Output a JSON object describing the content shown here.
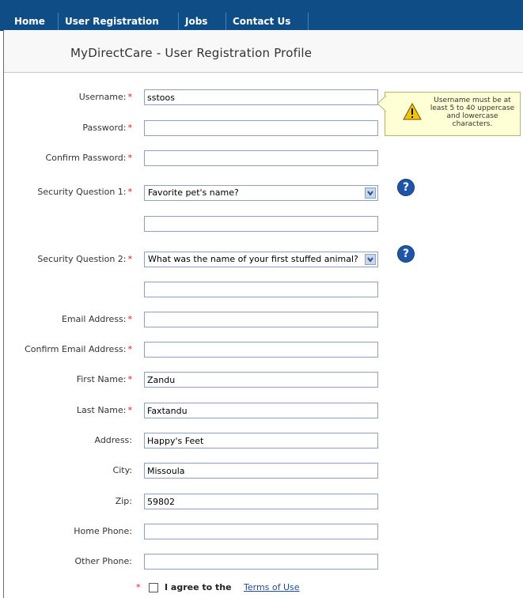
{
  "nav": {
    "items": [
      {
        "label": "Home"
      },
      {
        "label": "User Registration"
      },
      {
        "label": "Jobs"
      },
      {
        "label": "Contact Us"
      }
    ]
  },
  "page": {
    "title": "MyDirectCare - User Registration Profile"
  },
  "form": {
    "username": {
      "label": "Username:",
      "value": "sstoos"
    },
    "password": {
      "label": "Password:",
      "value": ""
    },
    "confirm_password": {
      "label": "Confirm Password:",
      "value": ""
    },
    "security_q1": {
      "label": "Security Question 1:",
      "selected": "Favorite pet's name?",
      "answer": ""
    },
    "security_q2": {
      "label": "Security Question 2:",
      "selected": "What was the name of your first stuffed animal?",
      "answer": ""
    },
    "email": {
      "label": "Email Address:",
      "value": ""
    },
    "confirm_email": {
      "label": "Confirm Email Address:",
      "value": ""
    },
    "first_name": {
      "label": "First Name:",
      "value": "Zandu"
    },
    "last_name": {
      "label": "Last Name:",
      "value": "Faxtandu"
    },
    "address": {
      "label": "Address:",
      "value": "Happy's Feet"
    },
    "city": {
      "label": "City:",
      "value": "Missoula"
    },
    "zip": {
      "label": "Zip:",
      "value": "59802"
    },
    "home_phone": {
      "label": "Home Phone:",
      "value": ""
    },
    "other_phone": {
      "label": "Other Phone:",
      "value": ""
    },
    "required_marker": "*",
    "agree": {
      "text": "I agree to the",
      "link": "Terms of Use"
    }
  },
  "tooltip": {
    "text": "Username must be at least 5 to 40 uppercase and lowercase characters.",
    "icon": "warning-icon"
  },
  "help": {
    "glyph": "?",
    "icon": "help-icon"
  }
}
